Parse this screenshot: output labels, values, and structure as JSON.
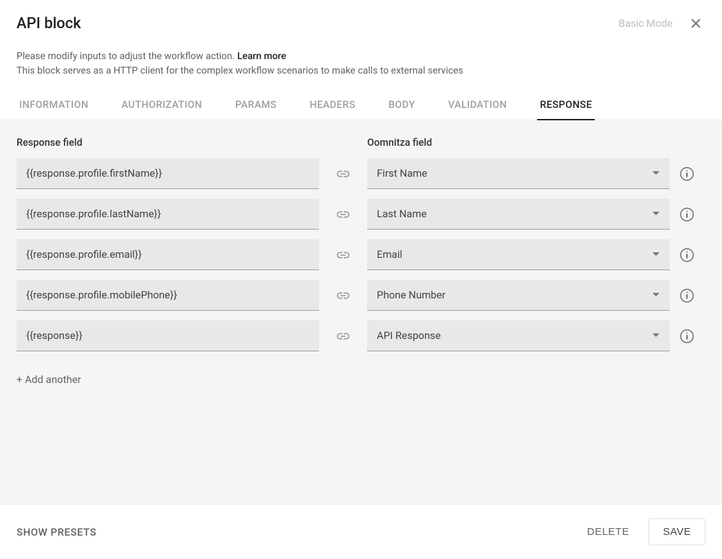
{
  "header": {
    "title": "API block",
    "basic_mode": "Basic Mode",
    "desc_prefix": "Please modify inputs to adjust the workflow action. ",
    "desc_link": "Learn more",
    "desc_line2": "This block serves as a HTTP client for the complex workflow scenarios to make calls to external services"
  },
  "tabs": [
    {
      "label": "INFORMATION",
      "active": false
    },
    {
      "label": "AUTHORIZATION",
      "active": false
    },
    {
      "label": "PARAMS",
      "active": false
    },
    {
      "label": "HEADERS",
      "active": false
    },
    {
      "label": "BODY",
      "active": false
    },
    {
      "label": "VALIDATION",
      "active": false
    },
    {
      "label": "RESPONSE",
      "active": true
    }
  ],
  "columns": {
    "left": "Response field",
    "right": "Oomnitza field"
  },
  "rows": [
    {
      "response": "{{response.profile.firstName}}",
      "oomnitza": "First Name"
    },
    {
      "response": "{{response.profile.lastName}}",
      "oomnitza": "Last Name"
    },
    {
      "response": "{{response.profile.email}}",
      "oomnitza": "Email"
    },
    {
      "response": "{{response.profile.mobilePhone}}",
      "oomnitza": "Phone Number"
    },
    {
      "response": "{{response}}",
      "oomnitza": "API Response"
    }
  ],
  "add_another": "+ Add another",
  "footer": {
    "show_presets": "SHOW PRESETS",
    "delete": "DELETE",
    "save": "SAVE"
  }
}
